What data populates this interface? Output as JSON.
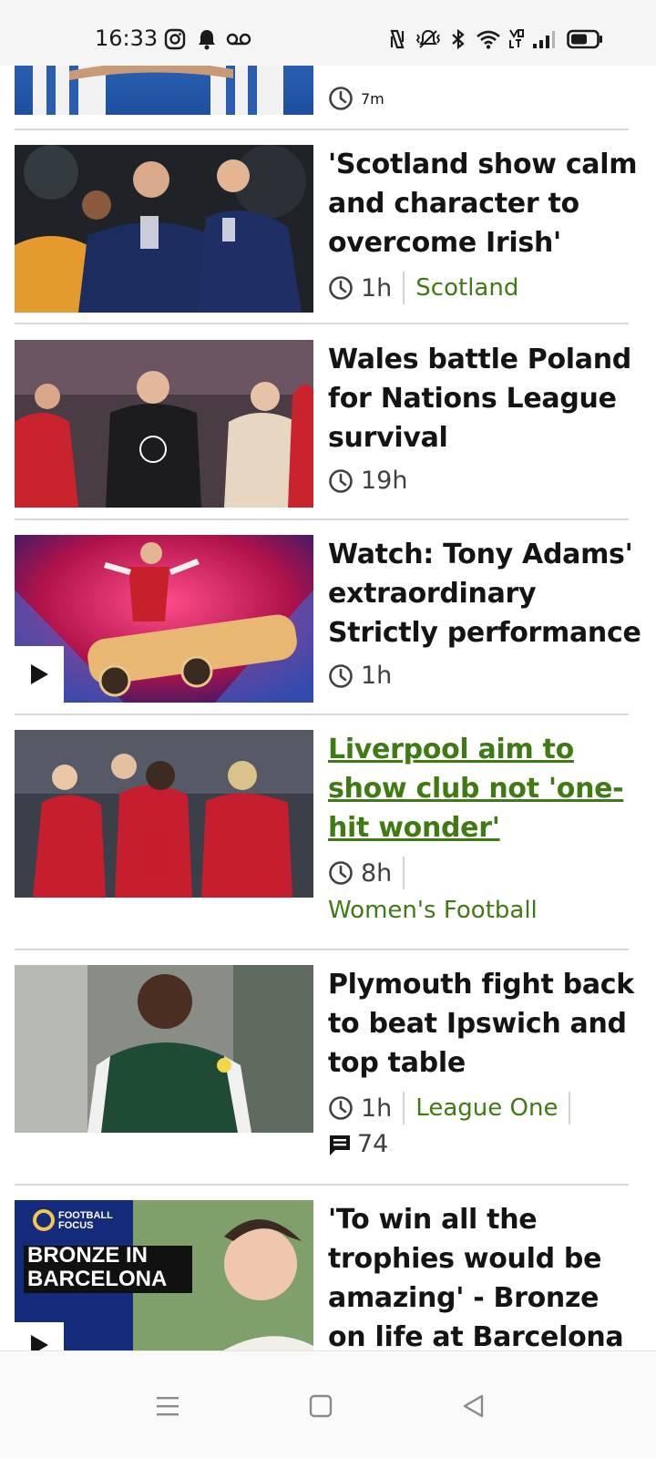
{
  "status_bar": {
    "time": "16:33",
    "left_icons": [
      "instagram-icon",
      "notification-bell-icon",
      "voicemail-icon"
    ],
    "right_icons": [
      "nfc-icon",
      "vibrate-icon",
      "bluetooth-icon",
      "wifi-icon",
      "volte-icon",
      "signal-icon",
      "battery-icon"
    ]
  },
  "partial_item": {
    "timestamp": "7m"
  },
  "articles": [
    {
      "headline": "'Scotland show calm and character to overcome Irish'",
      "timestamp": "1h",
      "tag": "Scotland",
      "has_video": false,
      "visited": false
    },
    {
      "headline": "Wales battle Poland for Nations League survival",
      "timestamp": "19h",
      "tag": "",
      "has_video": false,
      "visited": false
    },
    {
      "headline": "Watch: Tony Adams' extraordinary Strictly performance",
      "timestamp": "1h",
      "tag": "",
      "has_video": true,
      "visited": false
    },
    {
      "headline": "Liverpool aim to show club not 'one-hit wonder'",
      "timestamp": "8h",
      "tag": "Women's Football",
      "has_video": false,
      "visited": true
    },
    {
      "headline": "Plymouth fight back to beat Ipswich and top table",
      "timestamp": "1h",
      "tag": "League One",
      "comments": "74",
      "has_video": false,
      "visited": false
    },
    {
      "headline": "'To win all the trophies would be amazing' - Bronze on life at Barcelona",
      "has_video": true,
      "visited": false,
      "thumb_brand": "FOOTBALL FOCUS",
      "thumb_title": "BRONZE IN BARCELONA"
    }
  ],
  "nav_bar": {
    "icons": [
      "menu-icon",
      "home-square-icon",
      "back-triangle-icon"
    ]
  },
  "colors": {
    "link_green": "#3f7a14",
    "text": "#141414",
    "muted": "#404040",
    "divider": "#d8d8d8"
  }
}
